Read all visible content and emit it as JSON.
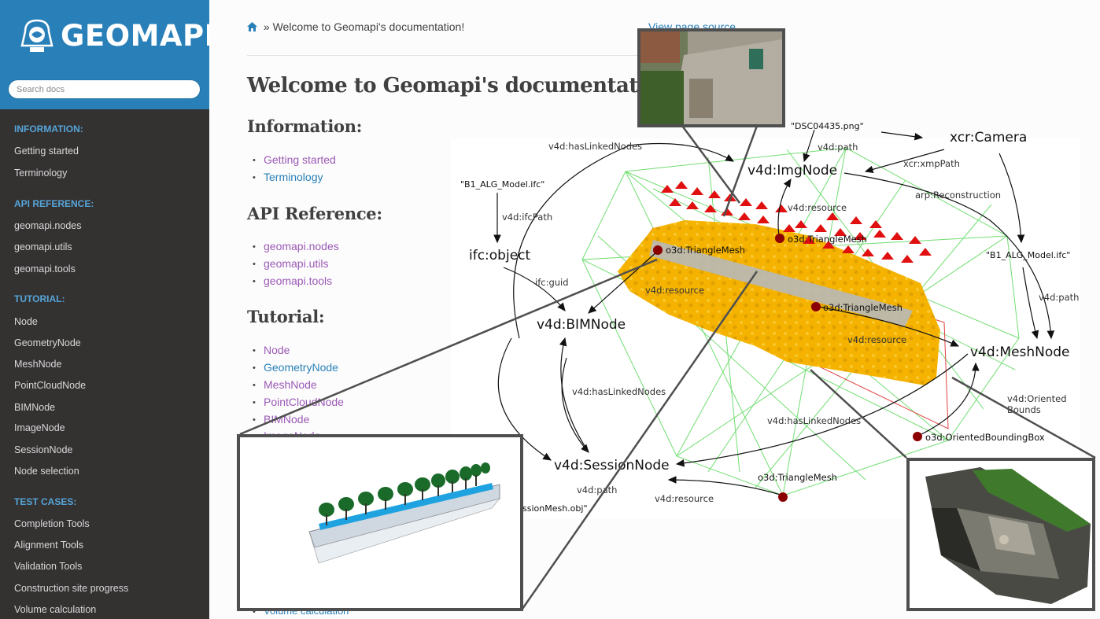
{
  "sidebar": {
    "brand": "GEOMAPI",
    "search_placeholder": "Search docs",
    "sections": [
      {
        "caption": "INFORMATION:",
        "items": [
          "Getting started",
          "Terminology"
        ]
      },
      {
        "caption": "API REFERENCE:",
        "items": [
          "geomapi.nodes",
          "geomapi.utils",
          "geomapi.tools"
        ]
      },
      {
        "caption": "TUTORIAL:",
        "items": [
          "Node",
          "GeometryNode",
          "MeshNode",
          "PointCloudNode",
          "BIMNode",
          "ImageNode",
          "SessionNode",
          "Node selection"
        ]
      },
      {
        "caption": "TEST CASES:",
        "items": [
          "Completion Tools",
          "Alignment Tools",
          "Validation Tools",
          "Construction site progress",
          "Volume calculation"
        ]
      }
    ]
  },
  "main": {
    "breadcrumb_sep": "»",
    "breadcrumb_current": "Welcome to Geomapi's documentation!",
    "view_source": "View page source",
    "title": "Welcome to Geomapi's documentation!",
    "information": {
      "heading": "Information:",
      "links": [
        "Getting started",
        "Terminology"
      ]
    },
    "api": {
      "heading": "API Reference:",
      "links": [
        "geomapi.nodes",
        "geomapi.utils",
        "geomapi.tools"
      ]
    },
    "tutorial": {
      "heading": "Tutorial:",
      "links": [
        "Node",
        "GeometryNode",
        "MeshNode",
        "PointCloudNode",
        "BIMNode",
        "ImageNode"
      ]
    },
    "bottom_link": "Volume calculation"
  },
  "graph": {
    "nodes": {
      "img": "v4d:ImgNode",
      "camera": "xcr:Camera",
      "ifc_object": "ifc:object",
      "bim": "v4d:BIMNode",
      "mesh": "v4d:MeshNode",
      "session": "v4d:SessionNode"
    },
    "literals": {
      "png": "\"DSC04435.png\"",
      "ifc1": "\"B1_ALG_Model.ifc\"",
      "ifc2": "\"B1_ALG_Model.ifc\"",
      "session_obj": "ssionMesh.obj\""
    },
    "edges": {
      "has_linked_top": "v4d:hasLinkedNodes",
      "path_img": "v4d:path",
      "xmp": "xcr:xmpPath",
      "reconstruction": "arp:Reconstruction",
      "ifc_path": "v4d:ifcPath",
      "resource_img": "v4d:resource",
      "ifc_guid": "ifc:guid",
      "resource_bim": "v4d:resource",
      "resource_mesh": "v4d:resource",
      "path_mesh": "v4d:path",
      "has_linked_mid": "v4d:hasLinkedNodes",
      "oriented_bounds_1": "v4d:Oriented",
      "oriented_bounds_2": "Bounds",
      "has_linked_low": "v4d:hasLinkedNodes",
      "path_session": "v4d:path",
      "resource_session": "v4d:resource"
    },
    "resources": {
      "tm_img": "o3d:TriangleMesh",
      "tm_bim": "o3d:TriangleMesh",
      "tm_mesh": "o3d:TriangleMesh",
      "obb": "o3d:OrientedBoundingBox",
      "tm_session": "o3d:TriangleMesh"
    }
  },
  "colors": {
    "sidebar_bg": "#343131",
    "brand_bg": "#2980b9",
    "link": "#2980b9",
    "visited": "#9b59b6",
    "caption": "#55a5d9",
    "mesh": "#f6b200",
    "wireframe": "#5ad85a",
    "cone": "#e01010",
    "node_dot": "#8b0000"
  }
}
